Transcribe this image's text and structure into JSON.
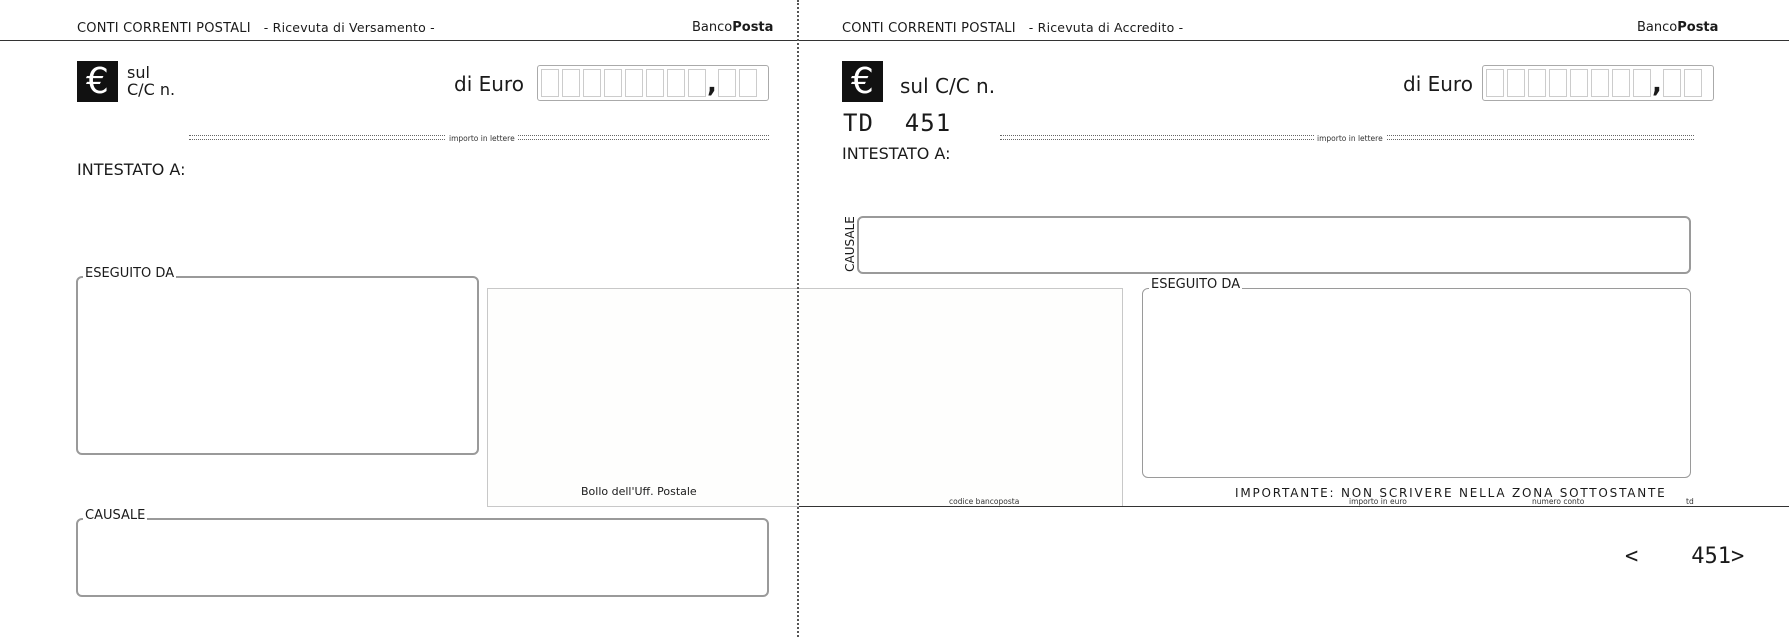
{
  "left": {
    "header_title": "CONTI CORRENTI POSTALI",
    "header_subtitle": "- Ricevuta di Versamento -",
    "brand_prefix": "Banco",
    "brand_bold": "Posta",
    "euro_symbol": "€",
    "account_label_line1": "sul",
    "account_label_line2": "C/C n.",
    "amount_label": "di Euro",
    "comma": ",",
    "words_caption": "importo in lettere",
    "holder_label": "INTESTATO A:",
    "payer_label": "ESEGUITO DA",
    "reason_label": "CAUSALE"
  },
  "stamp": {
    "stamp_label": "Bollo dell'Uff. Postale",
    "code_label": "codice bancoposta"
  },
  "right": {
    "header_title": "CONTI CORRENTI POSTALI",
    "header_subtitle": "- Ricevuta di Accredito -",
    "brand_prefix": "Banco",
    "brand_bold": "Posta",
    "euro_symbol": "€",
    "account_label": "sul C/C n.",
    "amount_label": "di Euro",
    "comma": ",",
    "form_code": "TD  451",
    "holder_label": "INTESTATO A:",
    "words_caption": "importo in lettere",
    "reason_label": "CAUSALE",
    "payer_label": "ESEGUITO DA",
    "important_notice": "IMPORTANTE: NON SCRIVERE NELLA ZONA SOTTOSTANTE",
    "footer_amount_caption": "importo in euro",
    "footer_account_caption": "numero conto",
    "footer_td_caption": "td",
    "ocr_line": "<    451>"
  }
}
